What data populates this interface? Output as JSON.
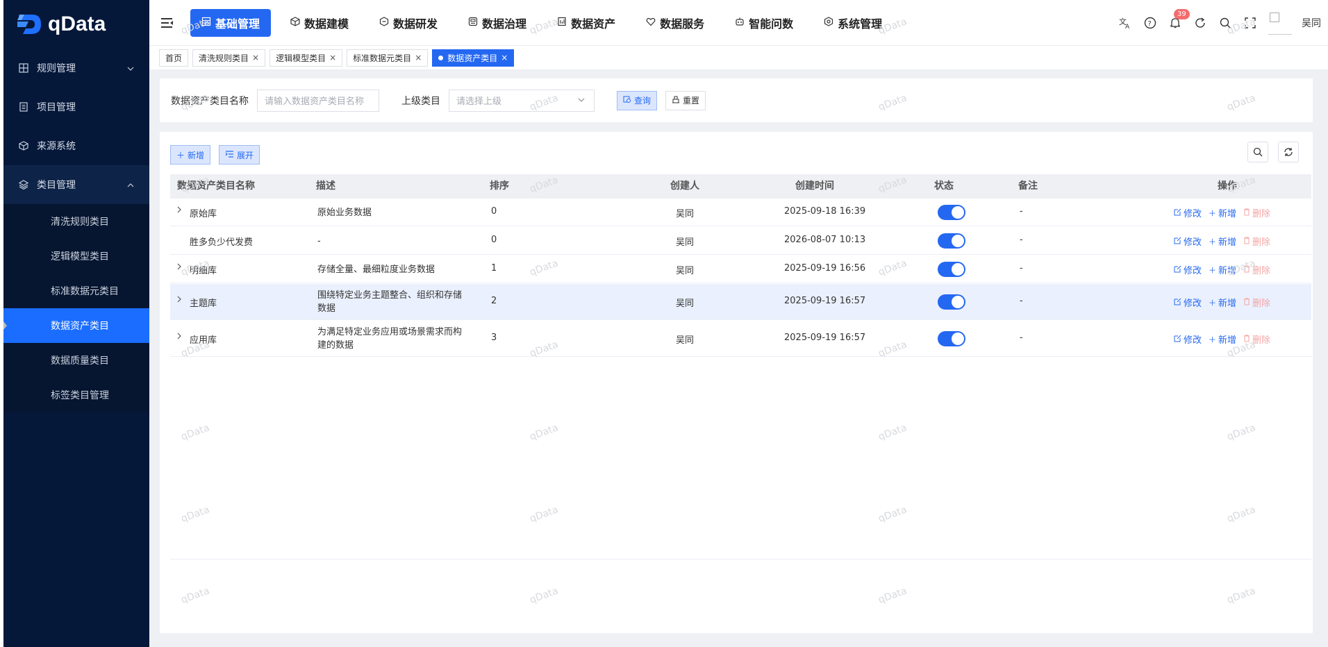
{
  "brand": {
    "name": "qData"
  },
  "sidebar": {
    "items": [
      {
        "label": "规则管理",
        "icon": "grid-icon",
        "expandable": true,
        "open": false
      },
      {
        "label": "项目管理",
        "icon": "document-icon",
        "expandable": false
      },
      {
        "label": "来源系统",
        "icon": "cube-icon",
        "expandable": false
      },
      {
        "label": "类目管理",
        "icon": "layers-icon",
        "expandable": true,
        "open": true
      }
    ],
    "sub_items": [
      {
        "label": "清洗规则类目",
        "active": false
      },
      {
        "label": "逻辑模型类目",
        "active": false
      },
      {
        "label": "标准数据元类目",
        "active": false
      },
      {
        "label": "数据资产类目",
        "active": true
      },
      {
        "label": "数据质量类目",
        "active": false
      },
      {
        "label": "标签类目管理",
        "active": false
      }
    ]
  },
  "topnav": {
    "items": [
      {
        "label": "基础管理",
        "icon": "table-icon",
        "active": true
      },
      {
        "label": "数据建模",
        "icon": "cube-icon",
        "active": false
      },
      {
        "label": "数据研发",
        "icon": "hexagon-icon",
        "active": false
      },
      {
        "label": "数据治理",
        "icon": "governance-icon",
        "active": false
      },
      {
        "label": "数据资产",
        "icon": "asset-icon",
        "active": false
      },
      {
        "label": "数据服务",
        "icon": "heart-icon",
        "active": false
      },
      {
        "label": "智能问数",
        "icon": "robot-icon",
        "active": false
      },
      {
        "label": "系统管理",
        "icon": "gear-icon",
        "active": false
      }
    ],
    "notification_count": "39",
    "username": "吴同"
  },
  "tabs": [
    {
      "label": "首页",
      "closable": false,
      "active": false
    },
    {
      "label": "清洗规则类目",
      "closable": true,
      "active": false
    },
    {
      "label": "逻辑模型类目",
      "closable": true,
      "active": false
    },
    {
      "label": "标准数据元类目",
      "closable": true,
      "active": false
    },
    {
      "label": "数据资产类目",
      "closable": true,
      "active": true
    }
  ],
  "search": {
    "name_label": "数据资产类目名称",
    "name_placeholder": "请输入数据资产类目名称",
    "parent_label": "上级类目",
    "parent_placeholder": "请选择上级",
    "query_button": "查询",
    "reset_button": "重置"
  },
  "toolbar": {
    "add_button": "新增",
    "expand_button": "展开"
  },
  "table": {
    "headers": {
      "name": "数据资产类目名称",
      "desc": "描述",
      "order": "排序",
      "creator": "创建人",
      "created_at": "创建时间",
      "status": "状态",
      "remark": "备注",
      "ops": "操作"
    },
    "rows": [
      {
        "name": "原始库",
        "desc": [
          "原始业务数据"
        ],
        "order": "0",
        "creator": "吴同",
        "created_at": "2025-09-18 16:39",
        "status": true,
        "remark": "-",
        "expandable": true
      },
      {
        "name": "胜多负少代发费",
        "desc": [
          "-"
        ],
        "order": "0",
        "creator": "吴同",
        "created_at": "2026-08-07 10:13",
        "status": true,
        "remark": "-",
        "expandable": false
      },
      {
        "name": "明细库",
        "desc": [
          "存储全量、最细粒度业务数据"
        ],
        "order": "1",
        "creator": "吴同",
        "created_at": "2025-09-19 16:56",
        "status": true,
        "remark": "-",
        "expandable": true
      },
      {
        "name": "主题库",
        "desc": [
          "围绕特定业务主题整合、组织和存储",
          "数据"
        ],
        "order": "2",
        "creator": "吴同",
        "created_at": "2025-09-19 16:57",
        "status": true,
        "remark": "-",
        "expandable": true,
        "highlighted": true
      },
      {
        "name": "应用库",
        "desc": [
          "为满足特定业务应用或场景需求而构",
          "建的数据"
        ],
        "order": "3",
        "creator": "吴同",
        "created_at": "2025-09-19 16:57",
        "status": true,
        "remark": "-",
        "expandable": true
      }
    ],
    "op_labels": {
      "edit": "修改",
      "add": "新增",
      "delete": "删除"
    }
  },
  "watermark": "qData",
  "colors": {
    "primary": "#2468f2",
    "sidebar_bg": "#05183a",
    "danger_light": "#f4a6a6",
    "badge": "#f56c6c"
  }
}
